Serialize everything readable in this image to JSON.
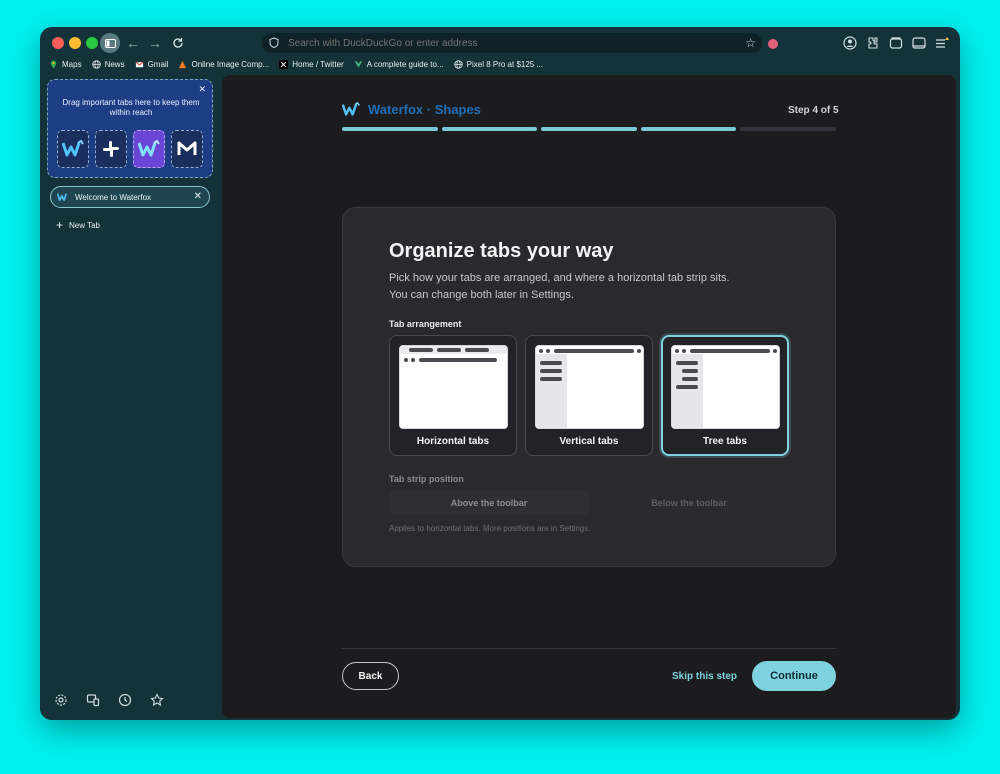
{
  "browser": {
    "url_placeholder": "Search with DuckDuckGo or enter address",
    "bookmarks": [
      {
        "label": "Maps"
      },
      {
        "label": "News"
      },
      {
        "label": "Gmail"
      },
      {
        "label": "Online Image Comp..."
      },
      {
        "label": "Home / Twitter"
      },
      {
        "label": "A complete guide to..."
      },
      {
        "label": "Pixel 8 Pro at $125 ..."
      }
    ]
  },
  "sidebar": {
    "pinned_hint": "Drag important tabs here to keep them within reach",
    "tabs": [
      {
        "label": "Welcome to Waterfox"
      }
    ],
    "new_tab_label": "New Tab"
  },
  "onboarding": {
    "brand": "Waterfox · Shapes",
    "step_label": "Step 4 of 5",
    "progress": {
      "current": 4,
      "total": 5
    },
    "title": "Organize tabs your way",
    "description_line1": "Pick how your tabs are arranged, and where a horizontal tab strip sits.",
    "description_line2": "You can change both later in Settings.",
    "arrangement_label": "Tab arrangement",
    "options": [
      {
        "label": "Horizontal tabs",
        "selected": false
      },
      {
        "label": "Vertical tabs",
        "selected": false
      },
      {
        "label": "Tree tabs",
        "selected": true
      }
    ],
    "strip_label": "Tab strip position",
    "strip_options": [
      "Above the toolbar",
      "Below the toolbar"
    ],
    "strip_note": "Applies to horizontal tabs. More positions are in Settings.",
    "back_label": "Back",
    "skip_label": "Skip this step",
    "continue_label": "Continue"
  },
  "colors": {
    "accent": "#7fd3e0",
    "chrome": "#14323a",
    "pinned_area": "#1d3d84"
  }
}
